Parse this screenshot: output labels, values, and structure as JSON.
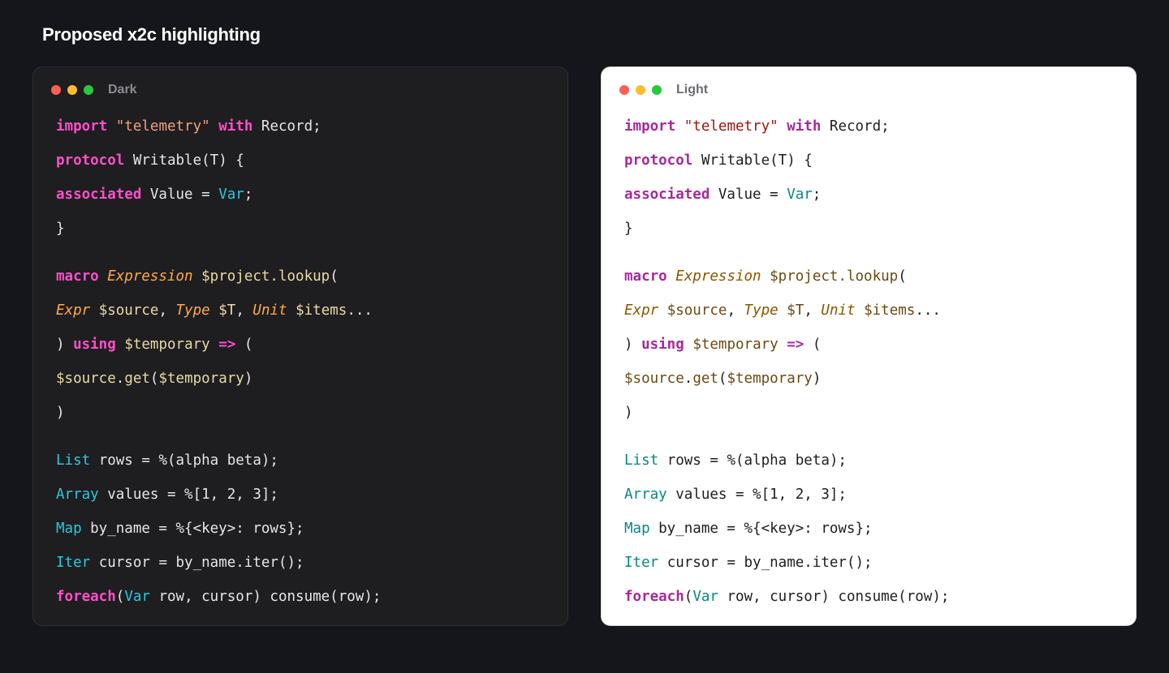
{
  "page_title": "Proposed x2c highlighting",
  "panels": [
    {
      "theme": "dark",
      "label": "Dark",
      "background": "#1e1e20",
      "token_colors": {
        "keyword": "#ff4fcb",
        "string": "#f0a07c",
        "type": "#2bc8e0",
        "italic_type": "#ffa94d",
        "variable": "#ead9a6",
        "plain": "#e6e6e6"
      }
    },
    {
      "theme": "light",
      "label": "Light",
      "background": "#ffffff",
      "token_colors": {
        "keyword": "#a8289c",
        "string": "#a1150c",
        "type": "#0a8585",
        "italic_type": "#8a5500",
        "variable": "#6b4a12",
        "plain": "#1e1e1e"
      }
    }
  ],
  "window_controls": [
    "close-dot",
    "minimize-dot",
    "maximize-dot"
  ],
  "code": [
    {
      "tokens": [
        {
          "t": "import",
          "c": "kw"
        },
        {
          "t": " ",
          "c": "pl"
        },
        {
          "t": "\"telemetry\"",
          "c": "str"
        },
        {
          "t": " ",
          "c": "pl"
        },
        {
          "t": "with",
          "c": "kw"
        },
        {
          "t": " Record;",
          "c": "pl"
        }
      ]
    },
    {
      "tokens": [
        {
          "t": "protocol",
          "c": "kw"
        },
        {
          "t": " Writable(T) {",
          "c": "pl"
        }
      ]
    },
    {
      "tokens": [
        {
          "t": "associated",
          "c": "kw"
        },
        {
          "t": " Value = ",
          "c": "pl"
        },
        {
          "t": "Var",
          "c": "ty"
        },
        {
          "t": ";",
          "c": "pl"
        }
      ]
    },
    {
      "tokens": [
        {
          "t": "}",
          "c": "pl"
        }
      ]
    },
    {
      "gap": true
    },
    {
      "tokens": [
        {
          "t": "macro",
          "c": "kw"
        },
        {
          "t": " ",
          "c": "pl"
        },
        {
          "t": "Expression",
          "c": "it"
        },
        {
          "t": " ",
          "c": "pl"
        },
        {
          "t": "$project.lookup",
          "c": "var"
        },
        {
          "t": "(",
          "c": "pl"
        }
      ]
    },
    {
      "tokens": [
        {
          "t": "Expr",
          "c": "it"
        },
        {
          "t": " ",
          "c": "pl"
        },
        {
          "t": "$source",
          "c": "var"
        },
        {
          "t": ", ",
          "c": "pl"
        },
        {
          "t": "Type",
          "c": "it"
        },
        {
          "t": " ",
          "c": "pl"
        },
        {
          "t": "$T",
          "c": "var"
        },
        {
          "t": ", ",
          "c": "pl"
        },
        {
          "t": "Unit",
          "c": "it"
        },
        {
          "t": " ",
          "c": "pl"
        },
        {
          "t": "$items",
          "c": "var"
        },
        {
          "t": "...",
          "c": "pl"
        }
      ]
    },
    {
      "tokens": [
        {
          "t": ") ",
          "c": "pl"
        },
        {
          "t": "using",
          "c": "kw"
        },
        {
          "t": " ",
          "c": "pl"
        },
        {
          "t": "$temporary",
          "c": "var"
        },
        {
          "t": " ",
          "c": "pl"
        },
        {
          "t": "=>",
          "c": "kw"
        },
        {
          "t": " (",
          "c": "pl"
        }
      ]
    },
    {
      "tokens": [
        {
          "t": "$source",
          "c": "var"
        },
        {
          "t": ".",
          "c": "pl"
        },
        {
          "t": "get",
          "c": "fn"
        },
        {
          "t": "(",
          "c": "pl"
        },
        {
          "t": "$temporary",
          "c": "var"
        },
        {
          "t": ")",
          "c": "pl"
        }
      ]
    },
    {
      "tokens": [
        {
          "t": ")",
          "c": "pl"
        }
      ]
    },
    {
      "gap": true
    },
    {
      "tokens": [
        {
          "t": "List",
          "c": "ty"
        },
        {
          "t": " rows = %(alpha beta);",
          "c": "pl"
        }
      ]
    },
    {
      "tokens": [
        {
          "t": "Array",
          "c": "ty"
        },
        {
          "t": " values = %[1, 2, 3];",
          "c": "pl"
        }
      ]
    },
    {
      "tokens": [
        {
          "t": "Map",
          "c": "ty"
        },
        {
          "t": " by_name = %{<key>: rows};",
          "c": "pl"
        }
      ]
    },
    {
      "tokens": [
        {
          "t": "Iter",
          "c": "ty"
        },
        {
          "t": " cursor = by_name.iter();",
          "c": "pl"
        }
      ]
    },
    {
      "tokens": [
        {
          "t": "foreach",
          "c": "kw"
        },
        {
          "t": "(",
          "c": "pl"
        },
        {
          "t": "Var",
          "c": "ty"
        },
        {
          "t": " row, cursor) consume(row);",
          "c": "pl"
        }
      ]
    }
  ]
}
